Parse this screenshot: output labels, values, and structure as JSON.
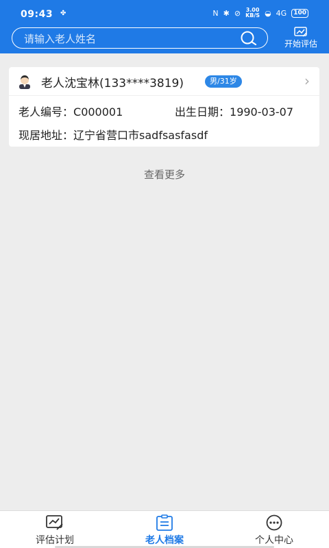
{
  "status": {
    "time": "09:43",
    "dot": "✤",
    "nfc": "N",
    "bt": "✱",
    "mute": "⊘",
    "speed_top": "3.00",
    "speed_bottom": "KB/S",
    "wifi": "◒",
    "signal": "4G",
    "battery": "100"
  },
  "header": {
    "search_placeholder": "请输入老人姓名",
    "assess_label": "开始评估"
  },
  "elder_card": {
    "name_line": "老人沈宝林(133****3819)",
    "badge": "男/31岁",
    "number_label": "老人编号：",
    "number_value": "C000001",
    "birth_label": "出生日期：",
    "birth_value": "1990-03-07",
    "address_label": "现居地址：",
    "address_value": "辽宁省营口市sadfsasfasdf",
    "chevron": "›"
  },
  "more_label": "查看更多",
  "tabs": [
    {
      "label": "评估计划",
      "icon": "chart-board-icon",
      "active": false
    },
    {
      "label": "老人档案",
      "icon": "clipboard-icon",
      "active": true
    },
    {
      "label": "个人中心",
      "icon": "chat-bubble-icon",
      "active": false
    }
  ],
  "colors": {
    "brand": "#1f7ae6",
    "badge": "#2d87e6",
    "background": "#ededed"
  }
}
